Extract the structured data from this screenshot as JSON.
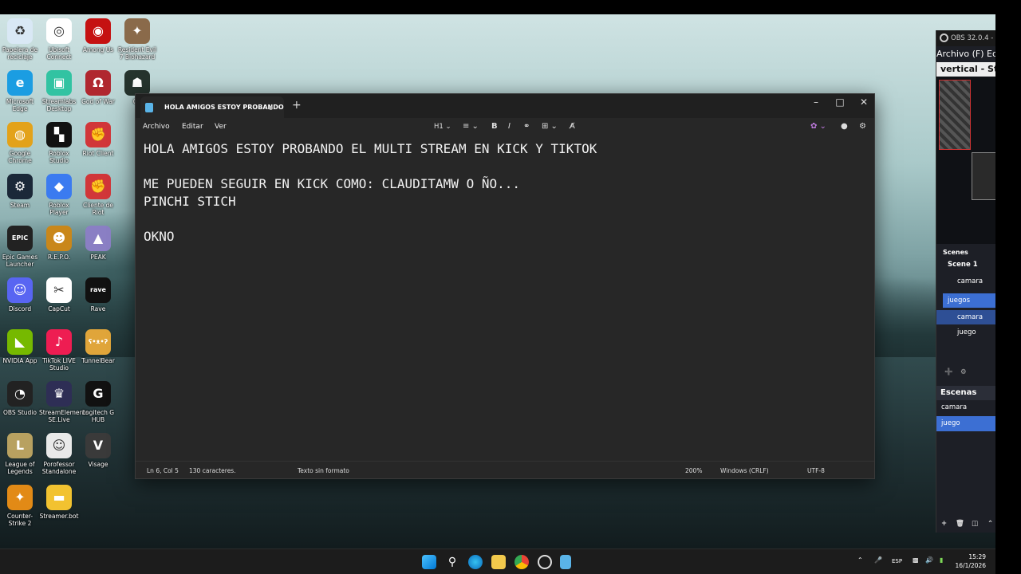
{
  "desktop_icons": [
    {
      "label": "Papelera de reciclaje",
      "color": "#d9e8f5",
      "glyph": "♻"
    },
    {
      "label": "Ubisoft Connect",
      "color": "#ffffff",
      "glyph": "◎"
    },
    {
      "label": "Among Us",
      "color": "#c51111",
      "glyph": "◉"
    },
    {
      "label": "Resident Evil 7 Biohazard",
      "color": "#8a6a4a",
      "glyph": "✦"
    },
    {
      "label": "Microsoft Edge",
      "color": "#1b9de2",
      "glyph": "e"
    },
    {
      "label": "Streamlabs Desktop",
      "color": "#31c3a2",
      "glyph": "▣"
    },
    {
      "label": "God of War",
      "color": "#b0272f",
      "glyph": "Ω"
    },
    {
      "label": "Gh",
      "color": "#26342e",
      "glyph": "☗"
    },
    {
      "label": "Google Chrome",
      "color": "#e3a21a",
      "glyph": "◍"
    },
    {
      "label": "Roblox Studio",
      "color": "#111111",
      "glyph": "▚"
    },
    {
      "label": "Riot Client",
      "color": "#d13639",
      "glyph": "✊"
    },
    {
      "label": "Steam",
      "color": "#1b2838",
      "glyph": "⚙"
    },
    {
      "label": "Roblox Player",
      "color": "#3b7bf0",
      "glyph": "◆"
    },
    {
      "label": "Cliente de Riot",
      "color": "#d13639",
      "glyph": "✊"
    },
    {
      "label": "Epic Games Launcher",
      "color": "#222222",
      "glyph": "EPIC"
    },
    {
      "label": "R.E.P.O.",
      "color": "#c9871a",
      "glyph": "☻"
    },
    {
      "label": "PEAK",
      "color": "#8a7fc4",
      "glyph": "▲"
    },
    {
      "label": "Discord",
      "color": "#5865f2",
      "glyph": "☺"
    },
    {
      "label": "CapCut",
      "color": "#ffffff",
      "glyph": "✂"
    },
    {
      "label": "Rave",
      "color": "#111111",
      "glyph": "rave"
    },
    {
      "label": "NVIDIA App",
      "color": "#76b900",
      "glyph": "◣"
    },
    {
      "label": "TikTok LIVE Studio",
      "color": "#ee1d52",
      "glyph": "♪"
    },
    {
      "label": "TunnelBear",
      "color": "#e0a53a",
      "glyph": "ʕ•ᴥ•ʔ"
    },
    {
      "label": "OBS Studio",
      "color": "#222222",
      "glyph": "◔"
    },
    {
      "label": "StreamElements SE.Live",
      "color": "#2e2e55",
      "glyph": "♛"
    },
    {
      "label": "Logitech G HUB",
      "color": "#111111",
      "glyph": "G"
    },
    {
      "label": "League of Legends",
      "color": "#b8a160",
      "glyph": "L"
    },
    {
      "label": "Porofessor Standalone",
      "color": "#e9e9e9",
      "glyph": "☺"
    },
    {
      "label": "Visage",
      "color": "#3a3a3a",
      "glyph": "V"
    },
    {
      "label": "Counter-Strike 2",
      "color": "#e28a16",
      "glyph": "✦"
    },
    {
      "label": "Streamer.bot",
      "color": "#f2c230",
      "glyph": "▬"
    }
  ],
  "notepad": {
    "tab_title": "HOLA AMIGOS ESTOY PROBANDO",
    "new_tab": "+",
    "menus": [
      "Archivo",
      "Editar",
      "Ver"
    ],
    "heading_select": "H1",
    "bold": "B",
    "italic": "I",
    "content": "HOLA AMIGOS ESTOY PROBANDO EL MULTI STREAM EN KICK Y TIKTOK\n\nME PUEDEN SEGUIR EN KICK COMO: CLAUDITAMW O ÑO...\nPINCHI STICH\n\nOKNO",
    "status": {
      "position": "Ln 6, Col 5",
      "chars": "130 caracteres.",
      "format": "Texto sin formato",
      "zoom": "200%",
      "line_ending": "Windows (CRLF)",
      "encoding": "UTF-8"
    }
  },
  "obs": {
    "title": "OBS 32.0.4 -",
    "menu": "Archivo (F) Edita",
    "header": "vertical - Stre",
    "scenes_label": "Scenes",
    "scene_name": "Scene 1",
    "sources": [
      {
        "label": "camara",
        "selected": false
      },
      {
        "label": "juegos",
        "selected": true
      },
      {
        "label": "camara",
        "selected": true
      },
      {
        "label": "juego",
        "selected": false
      }
    ],
    "escenas_label": "Escenas",
    "escenas": [
      {
        "label": "camara",
        "selected": false
      },
      {
        "label": "juego",
        "selected": true
      }
    ]
  },
  "taskbar": {
    "language": "ESP",
    "time": "15:29",
    "date": "16/1/2026"
  }
}
